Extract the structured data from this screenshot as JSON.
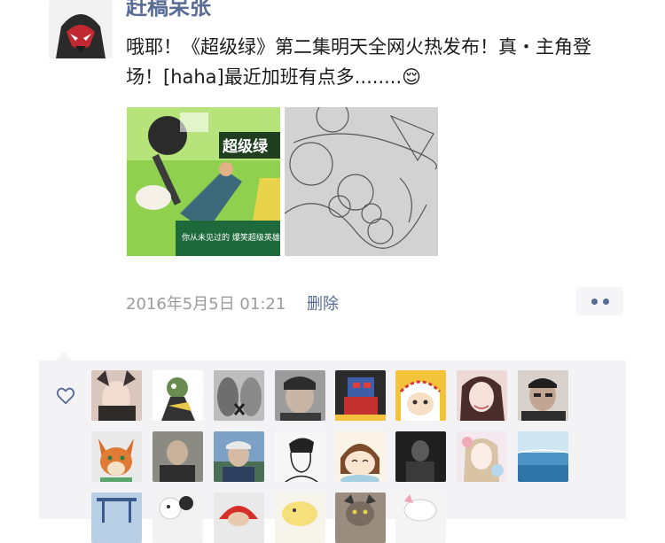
{
  "post": {
    "author": "赶稿呆张",
    "text": "哦耶！《超级绿》第二集明天全网火热发布！真・主角登场！[haha]最近加班有点多........😌",
    "timestamp": "2016年5月5日 01:21",
    "delete_label": "删除",
    "image_1_title": "超级绿",
    "image_1_caption": "你从未见过的 爆笑超级英雄喜剧!"
  },
  "likes": {
    "liker_count_visible": 22
  },
  "colors": {
    "link": "#576b95",
    "meta": "#9b9b9b",
    "panel": "#f3f3f5"
  },
  "icons": {
    "more": "more-dots-icon",
    "like": "heart-outline-icon"
  }
}
